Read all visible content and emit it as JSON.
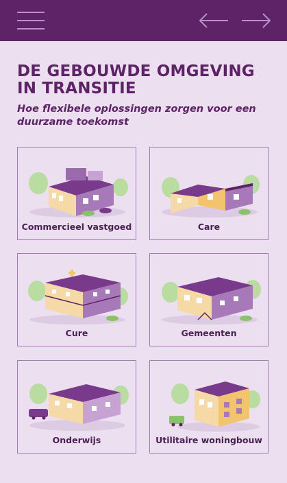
{
  "header": {
    "menu_icon": "hamburger-menu-icon",
    "back_icon": "arrow-left-icon",
    "forward_icon": "arrow-right-icon"
  },
  "title": "DE GEBOUWDE OMGEVING IN TRANSITIE",
  "subtitle": "Hoe flexibele oplossingen zorgen voor een duurzame toekomst",
  "colors": {
    "header_bg": "#5e2267",
    "page_bg": "#ebdff0",
    "accent_purple": "#7a3a8c",
    "accent_yellow": "#f2c46d",
    "accent_green": "#8ac16c"
  },
  "cards": [
    {
      "label": "Commercieel vastgoed",
      "icon": "commercial-building-illustration"
    },
    {
      "label": "Care",
      "icon": "care-building-illustration"
    },
    {
      "label": "Cure",
      "icon": "hospital-building-illustration"
    },
    {
      "label": "Gemeenten",
      "icon": "municipal-building-illustration"
    },
    {
      "label": "Onderwijs",
      "icon": "school-building-illustration"
    },
    {
      "label": "Utilitaire woningbouw",
      "icon": "residential-building-illustration"
    }
  ]
}
